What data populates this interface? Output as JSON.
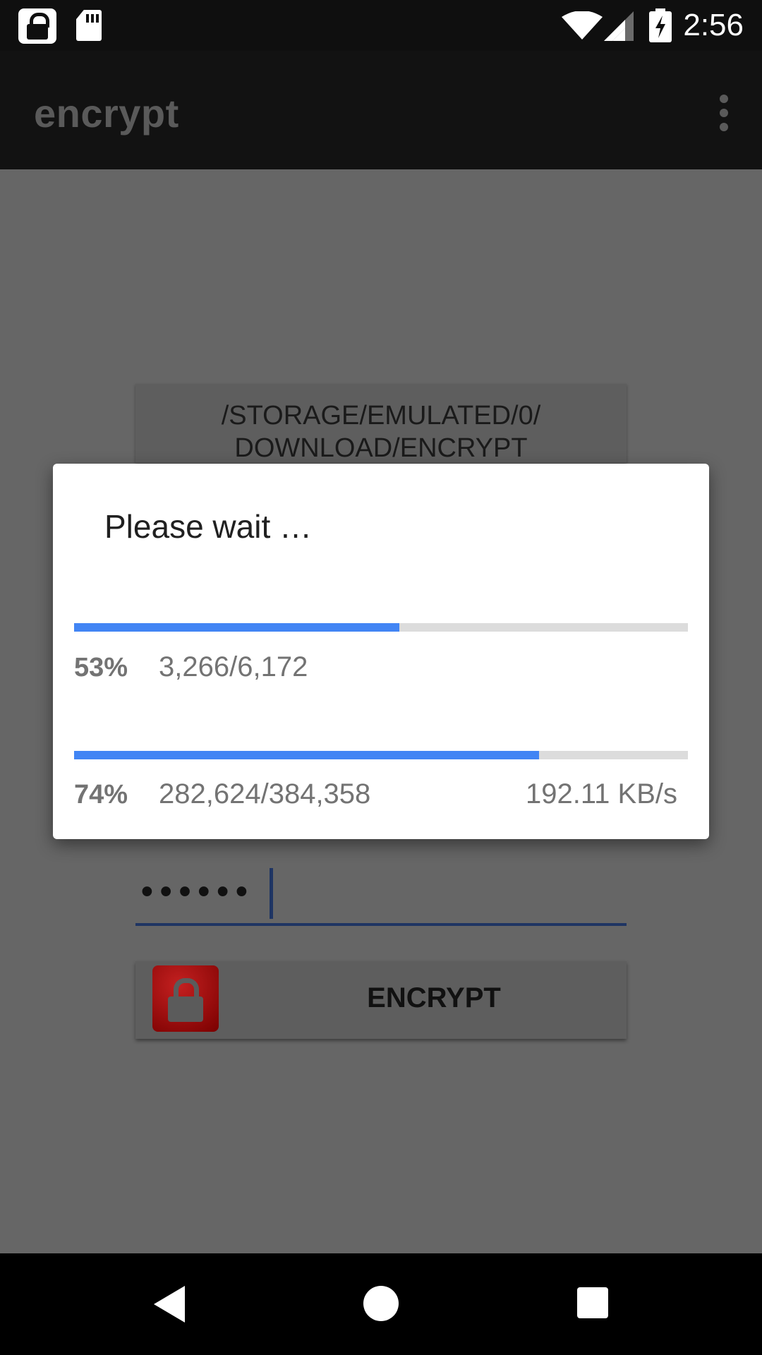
{
  "status_bar": {
    "time": "2:56",
    "icons": [
      "lock-icon",
      "sd-card-icon",
      "wifi-icon",
      "cell-signal-icon",
      "battery-charging-icon"
    ]
  },
  "app_bar": {
    "title": "encrypt",
    "menu_icon": "overflow-menu-icon"
  },
  "main": {
    "path_button_label": "/STORAGE/EMULATED/0/\nDOWNLOAD/ENCRYPT",
    "password_value": "••••••",
    "encrypt_button_label": "ENCRYPT",
    "encrypt_icon": "red-lock-icon"
  },
  "dialog": {
    "title": "Please wait …",
    "progress_overall": {
      "percent_label": "53%",
      "fraction": 0.53,
      "count": "3,266/6,172"
    },
    "progress_file": {
      "percent_label": "74%",
      "fraction": 0.758,
      "count": "282,624/384,358",
      "speed": "192.11 KB/s"
    }
  },
  "colors": {
    "progress_fill": "#4285f4",
    "progress_track": "#dcdcdc",
    "scrim": "#666666",
    "accent_underline": "#1f3563"
  },
  "nav_bar": {
    "icons": [
      "back-icon",
      "home-icon",
      "recents-icon"
    ]
  }
}
